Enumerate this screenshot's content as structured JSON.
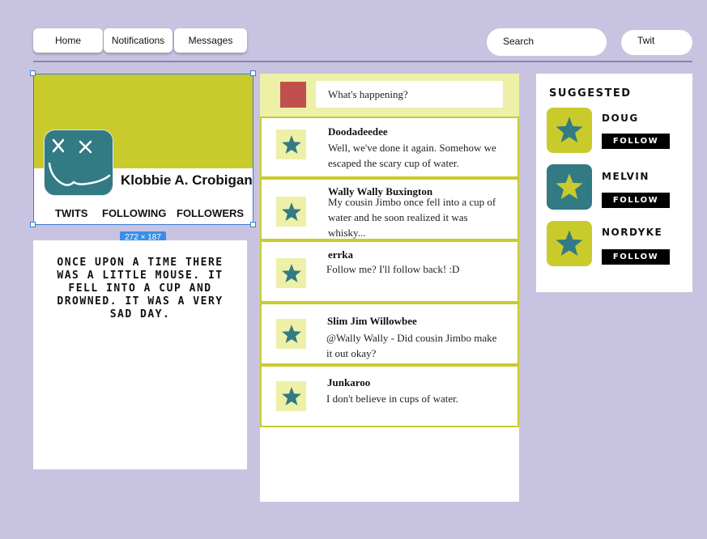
{
  "nav": {
    "home": "Home",
    "notifications": "Notifications",
    "messages": "Messages",
    "search_placeholder": "Search",
    "twit_button": "Twit"
  },
  "profile": {
    "name": "Klobbie A. Crobigan",
    "tabs": [
      "TWITS",
      "FOLLOWING",
      "FOLLOWERS"
    ],
    "size_badge": "272 × 187",
    "banner_color": "#c9cb2c",
    "avatar_color": "#327a84"
  },
  "story": {
    "text": "ONCE UPON A TIME THERE WAS A LITTLE MOUSE. IT FELL INTO A CUP AND DROWNED. IT WAS A VERY SAD DAY."
  },
  "compose": {
    "placeholder": "What's happening?"
  },
  "tweets": [
    {
      "name": "Doodadeedee",
      "text": "Well, we've done it again. Somehow we escaped the scary cup of water."
    },
    {
      "name": "Wally Wally Buxington",
      "text": "My cousin Jimbo once fell into a cup of water and he soon realized it was whisky..."
    },
    {
      "name": "errka",
      "text": "Follow me? I'll follow back! :D"
    },
    {
      "name": "Slim Jim Willowbee",
      "text": "@Wally Wally - Did cousin Jimbo make it out okay?"
    },
    {
      "name": "Junkaroo",
      "text": "I don't believe in cups of water."
    }
  ],
  "suggested": {
    "title": "SUGGESTED",
    "follow_label": "FOLLOW",
    "users": [
      {
        "name": "DOUG",
        "bg": "#c9cb2c",
        "star": "#327a84"
      },
      {
        "name": "MELVIN",
        "bg": "#327a84",
        "star": "#c9cb2c"
      },
      {
        "name": "NORDYKE",
        "bg": "#c9cb2c",
        "star": "#327a84"
      }
    ]
  },
  "colors": {
    "background": "#c8c3e1",
    "accent_yellow": "#c9cb2c",
    "accent_teal": "#327a84",
    "compose_square": "#c0504d",
    "selection_blue": "#3a7bd5"
  }
}
